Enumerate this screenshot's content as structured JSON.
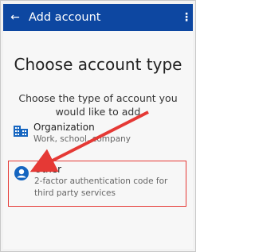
{
  "appbar": {
    "back_icon": "←",
    "title": "Add account",
    "more_icon": "⋮"
  },
  "main": {
    "heading": "Choose account type",
    "subheading": "Choose the type of account you would like to add",
    "options": [
      {
        "title": "Organization",
        "description": "Work, school, company",
        "icon": "building-icon"
      },
      {
        "title": "Other",
        "description": "2-factor authentication code for third party services",
        "icon": "person-circle-icon"
      }
    ]
  },
  "colors": {
    "appbar": "#0d47a1",
    "accent_blue": "#1565c0",
    "highlight_red": "#e53935"
  }
}
